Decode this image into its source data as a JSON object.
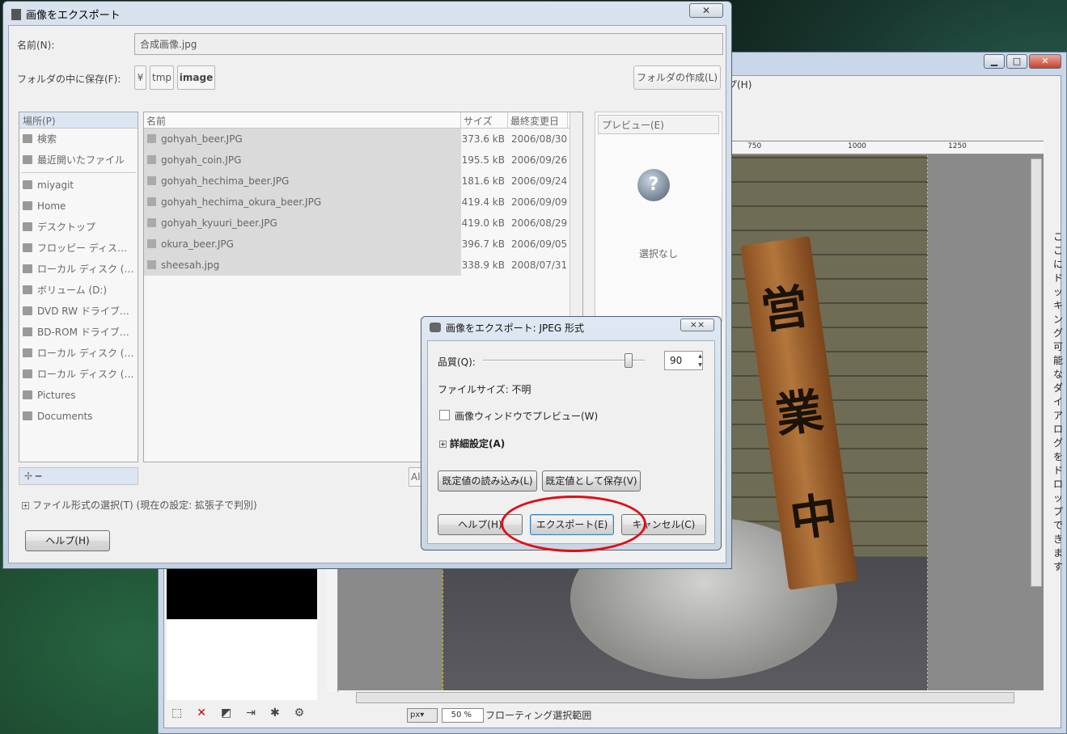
{
  "background_window": {
    "caption_buttons": [
      "▁",
      "□",
      "✕"
    ],
    "menu_help": "プ(H)",
    "ruler_ticks": [
      "750",
      "1000",
      "1250"
    ],
    "sign_chars": [
      "営",
      "業",
      "中"
    ],
    "dock_hint": "ここにドッキング可能なダイアログをドロップできます",
    "unit": "px▾",
    "zoom": "50 %",
    "status": "フローティング選択範囲"
  },
  "export_dialog": {
    "title": "画像をエクスポート",
    "close": "✕",
    "name_label": "名前(N):",
    "name_value": "合成画像.jpg",
    "folder_label": "フォルダの中に保存(F):",
    "breadcrumbs": [
      "¥",
      "tmp",
      "image"
    ],
    "create_folder": "フォルダの作成(L)",
    "places": {
      "header": "場所(P)",
      "items": [
        "検索",
        "最近開いたファイル",
        "miyagit",
        "Home",
        "デスクトップ",
        "フロッピー ディス…",
        "ローカル ディスク (…",
        "ボリューム (D:)",
        "DVD RW ドライブ…",
        "BD-ROM ドライブ…",
        "ローカル ディスク (…",
        "ローカル ディスク (…",
        "Pictures",
        "Documents"
      ],
      "add": "✢  ━"
    },
    "files": {
      "columns": [
        "名前",
        "サイズ",
        "最終変更日"
      ],
      "rows": [
        {
          "name": "gohyah_beer.JPG",
          "size": "373.6 kB",
          "date": "2006/08/30"
        },
        {
          "name": "gohyah_coin.JPG",
          "size": "195.5 kB",
          "date": "2006/09/26"
        },
        {
          "name": "gohyah_hechima_beer.JPG",
          "size": "181.6 kB",
          "date": "2006/09/24"
        },
        {
          "name": "gohyah_hechima_okura_beer.JPG",
          "size": "419.4 kB",
          "date": "2006/09/09"
        },
        {
          "name": "gohyah_kyuuri_beer.JPG",
          "size": "419.0 kB",
          "date": "2006/08/29"
        },
        {
          "name": "okura_beer.JPG",
          "size": "396.7 kB",
          "date": "2006/09/05"
        },
        {
          "name": "sheesah.jpg",
          "size": "338.9 kB",
          "date": "2008/07/31"
        }
      ],
      "filter": "All"
    },
    "preview": {
      "header": "プレビュー(E)",
      "icon": "?",
      "empty": "選択なし"
    },
    "file_type": "ファイル形式の選択(T) (現在の設定: 拡張子で判別)",
    "help": "ヘルプ(H)"
  },
  "jpeg_dialog": {
    "title": "画像をエクスポート: JPEG 形式",
    "close": "⨯⨯",
    "quality_label": "品質(Q):",
    "quality_value": "90",
    "quality_fraction": 0.9,
    "file_size": "ファイルサイズ: 不明",
    "preview_checkbox": "画像ウィンドウでプレビュー(W)",
    "advanced": "詳細設定(A)",
    "load_defaults": "既定値の読み込み(L)",
    "save_defaults": "既定値として保存(V)",
    "help": "ヘルプ(H)",
    "export": "エクスポート(E)",
    "cancel": "キャンセル(C)"
  }
}
